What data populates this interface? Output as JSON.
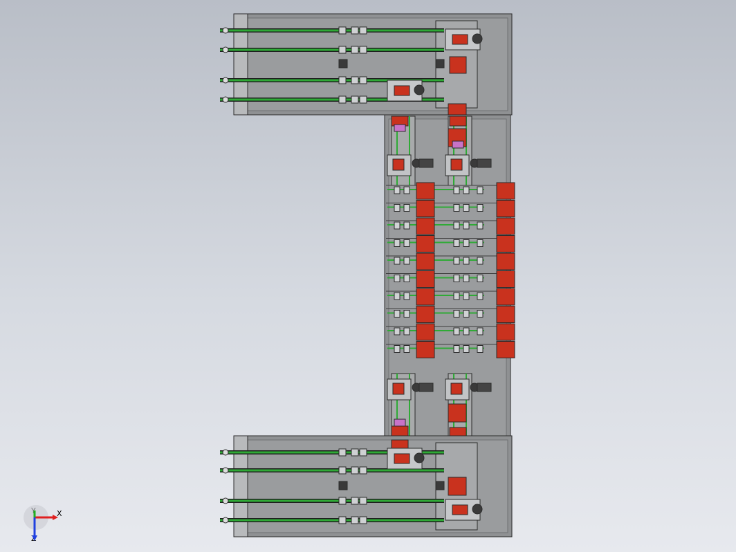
{
  "view": {
    "background_top": "#b9bec7",
    "background_bottom": "#e7e9ee"
  },
  "model": {
    "frame_fill": "#8f9193",
    "frame_inner": "#9a9c9e",
    "frame_edge": "#2b2b2b",
    "conveyor_color": "#2faa36",
    "actuator_color": "#c9321e",
    "cylinder_color": "#c873c8",
    "upper_module": {
      "rails": 4
    },
    "lower_module": {
      "rails": 4
    },
    "center_module": {
      "station_rows": 10,
      "columns": 2,
      "side_blocks": 10
    }
  },
  "triad": {
    "x_label": "X",
    "y_label": "Y",
    "z_label": "Z",
    "x_color": "#e02020",
    "y_color": "#20b020",
    "z_color": "#2040e0"
  }
}
